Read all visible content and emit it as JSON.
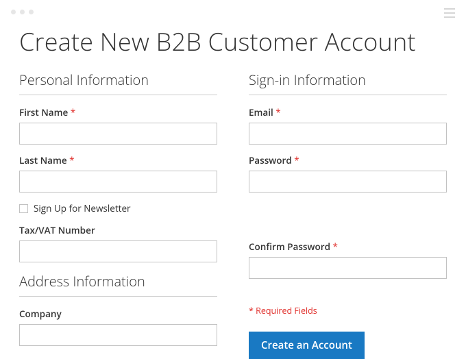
{
  "page": {
    "title": "Create New B2B Customer Account"
  },
  "sections": {
    "personal": {
      "heading": "Personal Information",
      "first_name_label": "First Name",
      "first_name_value": "",
      "last_name_label": "Last Name",
      "last_name_value": "",
      "newsletter_label": "Sign Up for Newsletter",
      "newsletter_checked": false,
      "tax_vat_label": "Tax/VAT Number",
      "tax_vat_value": ""
    },
    "address": {
      "heading": "Address Information",
      "company_label": "Company",
      "company_value": ""
    },
    "signin": {
      "heading": "Sign-in Information",
      "email_label": "Email",
      "email_value": "",
      "password_label": "Password",
      "password_value": "",
      "confirm_password_label": "Confirm Password",
      "confirm_password_value": ""
    }
  },
  "required_star": "*",
  "required_fields_note": "* Required Fields",
  "actions": {
    "create_account_label": "Create an Account"
  }
}
